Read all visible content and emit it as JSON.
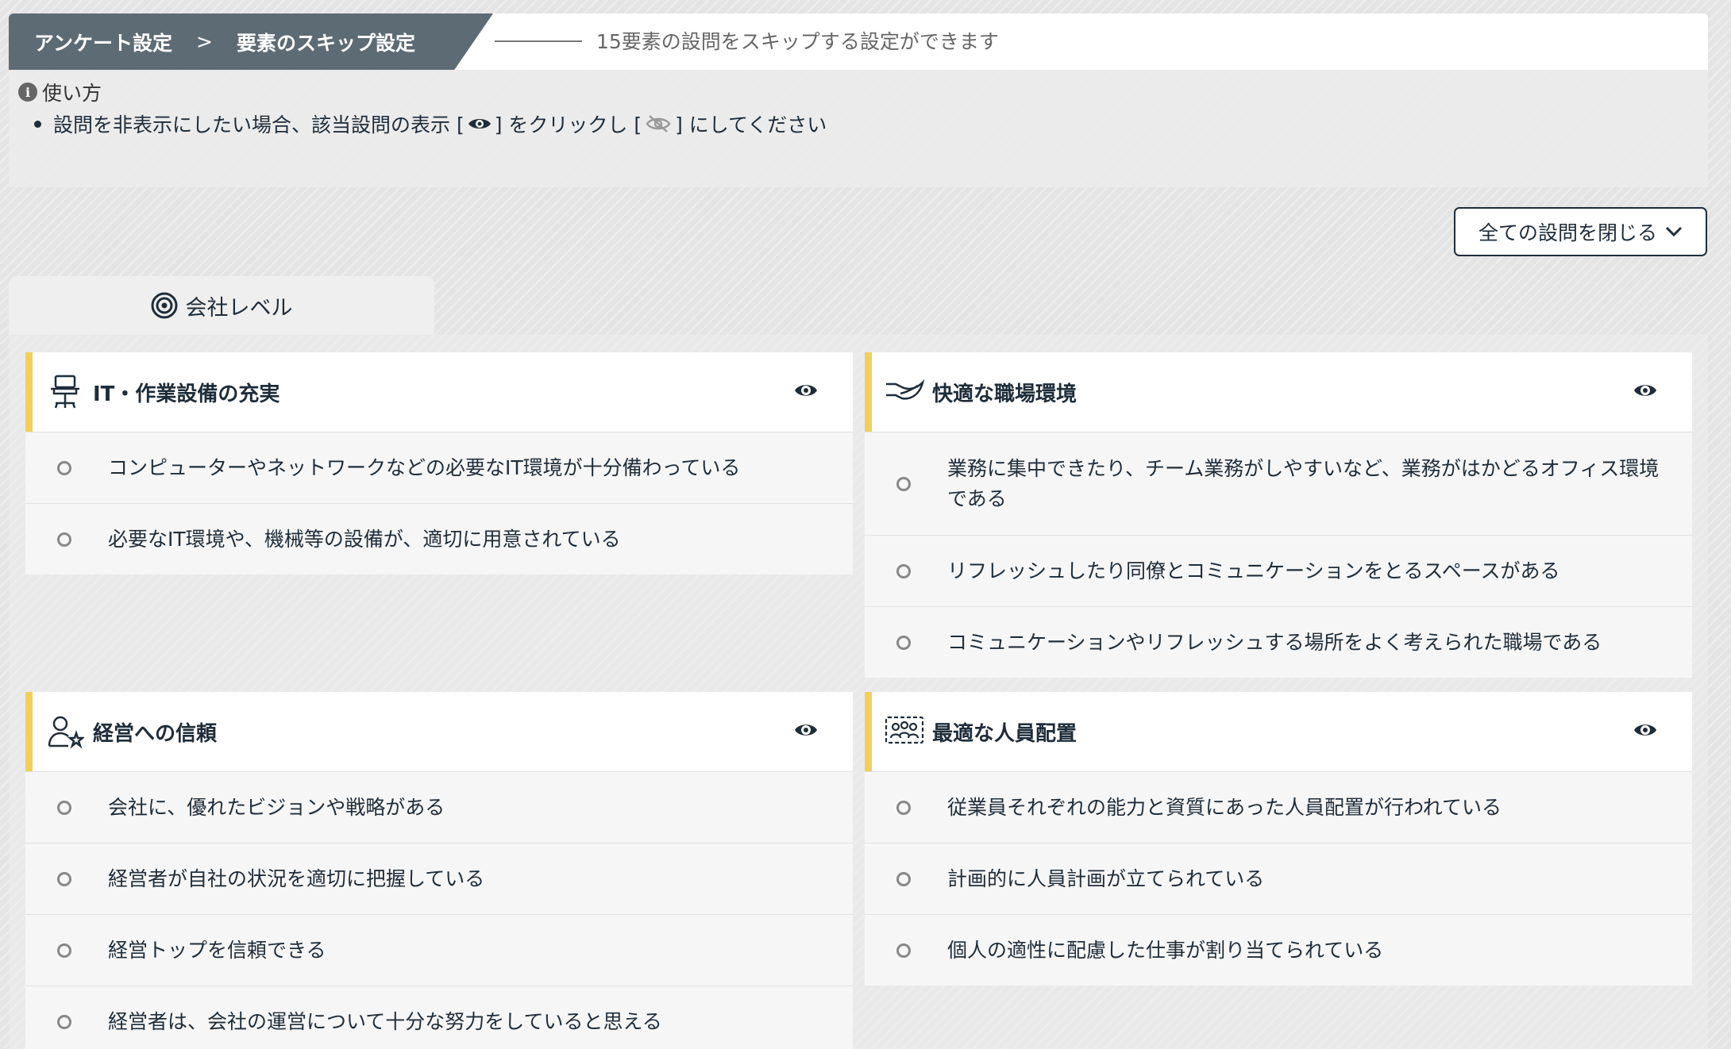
{
  "header": {
    "crumb_root": "アンケート設定",
    "crumb_sep": ">",
    "crumb_current": "要素のスキップ設定",
    "description": "15要素の設問をスキップする設定ができます"
  },
  "howto": {
    "title": "使い方",
    "item_before": "設問を非表示にしたい場合、該当設問の表示 [",
    "item_middle": "] をクリックし [",
    "item_after": "] にしてください"
  },
  "collapse_button": "全ての設問を閉じる",
  "tab": {
    "label": "会社レベル"
  },
  "cards": [
    {
      "title": "IT・作業設備の充実",
      "icon": "office-chair-icon",
      "questions": [
        "コンピューターやネットワークなどの必要なIT環境が十分備わっている",
        "必要なIT環境や、機械等の設備が、適切に用意されている"
      ]
    },
    {
      "title": "快適な職場環境",
      "icon": "leaf-hand-icon",
      "questions": [
        "業務に集中できたり、チーム業務がしやすいなど、業務がはかどるオフィス環境である",
        "リフレッシュしたり同僚とコミュニケーションをとるスペースがある",
        "コミュニケーションやリフレッシュする場所をよく考えられた職場である"
      ]
    },
    {
      "title": "経営への信頼",
      "icon": "person-star-icon",
      "questions": [
        "会社に、優れたビジョンや戦略がある",
        "経営者が自社の状況を適切に把握している",
        "経営トップを信頼できる",
        "経営者は、会社の運営について十分な努力をしていると思える"
      ]
    },
    {
      "title": "最適な人員配置",
      "icon": "team-placement-icon",
      "questions": [
        "従業員それぞれの能力と資質にあった人員配置が行われている",
        "計画的に人員計画が立てられている",
        "個人の適性に配慮した仕事が割り当てられている"
      ]
    }
  ]
}
